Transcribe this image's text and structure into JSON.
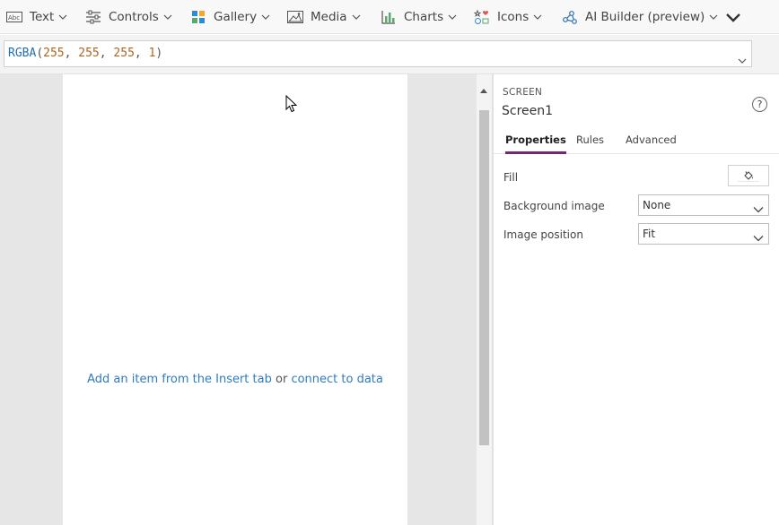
{
  "toolbar": {
    "items": [
      {
        "label": "Text",
        "icon": "text-label-icon"
      },
      {
        "label": "Controls",
        "icon": "controls-icon"
      },
      {
        "label": "Gallery",
        "icon": "gallery-icon"
      },
      {
        "label": "Media",
        "icon": "media-icon"
      },
      {
        "label": "Charts",
        "icon": "charts-icon"
      },
      {
        "label": "Icons",
        "icon": "icons-icon"
      },
      {
        "label": "AI Builder (preview)",
        "icon": "ai-builder-icon"
      }
    ]
  },
  "formula": {
    "fn": "RGBA",
    "open": "(",
    "args": [
      "255",
      "255",
      "255",
      "1"
    ],
    "close": ")"
  },
  "canvas": {
    "empty_text_link1": "Add an item from the Insert tab",
    "empty_text_or": " or ",
    "empty_text_link2": "connect to data"
  },
  "panel": {
    "type_label": "SCREEN",
    "name": "Screen1",
    "help": "?",
    "tabs": [
      "Properties",
      "Rules",
      "Advanced"
    ],
    "fill_label": "Fill",
    "background_image_label": "Background image",
    "background_image_value": "None",
    "image_position_label": "Image position",
    "image_position_value": "Fit"
  },
  "colors": {
    "accent_tab": "#742774",
    "link": "#2f7bbf",
    "fill_value": "#ffffff"
  }
}
